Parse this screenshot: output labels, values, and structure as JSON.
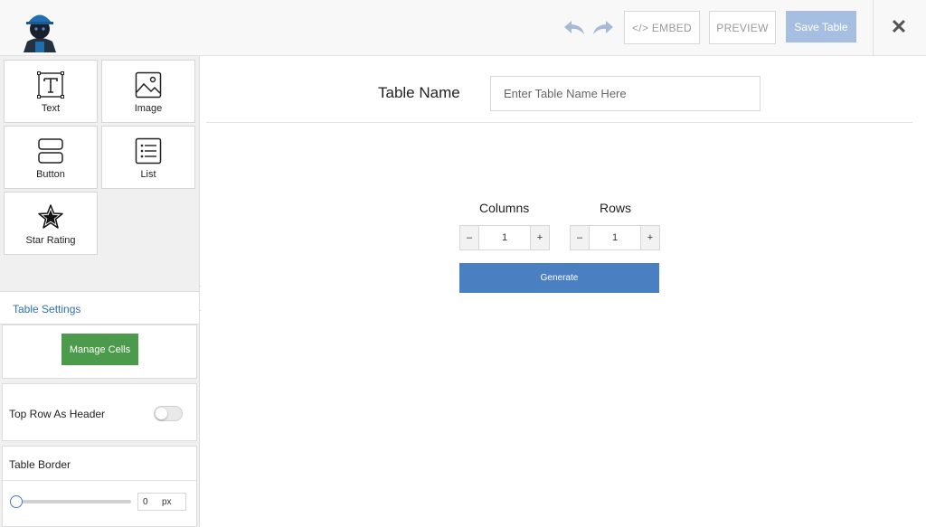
{
  "header": {
    "embed_label": "</> EMBED",
    "preview_label": "PREVIEW",
    "save_label": "Save Table",
    "close_glyph": "✕"
  },
  "sidebar": {
    "elements": [
      {
        "label": "Text",
        "icon": "text-icon"
      },
      {
        "label": "Image",
        "icon": "image-icon"
      },
      {
        "label": "Button",
        "icon": "button-icon"
      },
      {
        "label": "List",
        "icon": "list-icon"
      },
      {
        "label": "Star Rating",
        "icon": "star-icon"
      }
    ],
    "settings_title": "Table Settings",
    "manage_cells_label": "Manage Cells",
    "top_row_header_label": "Top Row As Header",
    "top_row_header_on": false,
    "table_border_label": "Table Border",
    "border_value": "0",
    "border_unit": "px"
  },
  "main": {
    "table_name_label": "Table Name",
    "table_name_placeholder": "Enter Table Name Here",
    "columns_label": "Columns",
    "rows_label": "Rows",
    "columns_value": "1",
    "rows_value": "1",
    "minus_glyph": "–",
    "plus_glyph": "+",
    "generate_label": "Generate"
  },
  "colors": {
    "save_button": "#a6bfe0",
    "manage_cells": "#4c9a4c",
    "generate": "#4a7fc1",
    "accent_text": "#2e6fb0"
  }
}
